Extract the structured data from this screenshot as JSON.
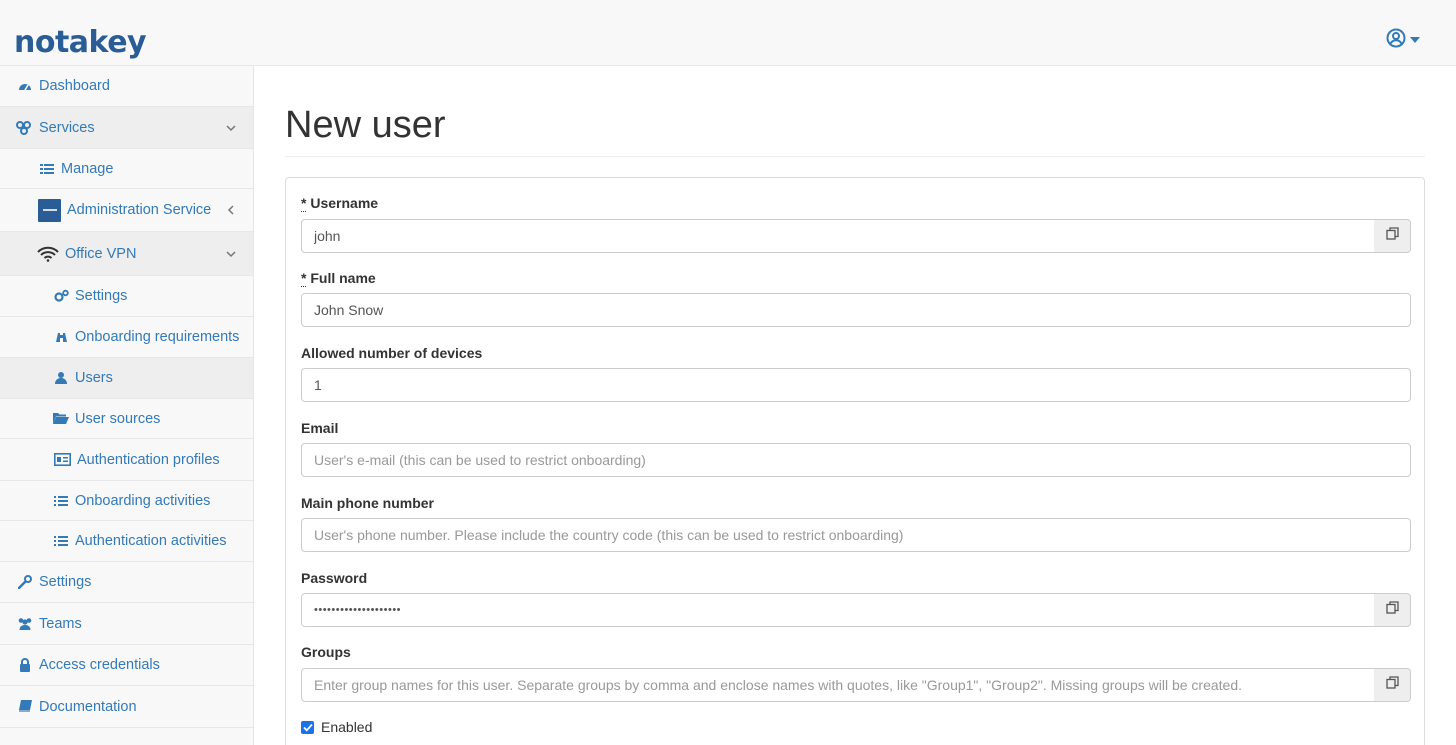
{
  "brand": {
    "logo_text": "notakey",
    "color": "#2a5d96"
  },
  "header": {
    "user_icon": "user-circle-icon",
    "dropdown_icon": "caret-down-icon"
  },
  "sidebar": {
    "items": [
      {
        "label": "Dashboard",
        "icon": "dashboard-icon"
      },
      {
        "label": "Services",
        "icon": "services-icon"
      },
      {
        "label": "Manage",
        "icon": "list-icon"
      },
      {
        "label": "Administration Service",
        "icon": "service-logo-icon"
      },
      {
        "label": "Office VPN",
        "icon": "wifi-icon"
      },
      {
        "label": "Settings",
        "icon": "cogs-icon"
      },
      {
        "label": "Onboarding requirements",
        "icon": "binoculars-icon"
      },
      {
        "label": "Users",
        "icon": "user-icon"
      },
      {
        "label": "User sources",
        "icon": "folder-open-icon"
      },
      {
        "label": "Authentication profiles",
        "icon": "id-card-icon"
      },
      {
        "label": "Onboarding activities",
        "icon": "list-icon"
      },
      {
        "label": "Authentication activities",
        "icon": "list-icon"
      },
      {
        "label": "Settings",
        "icon": "wrench-icon"
      },
      {
        "label": "Teams",
        "icon": "users-icon"
      },
      {
        "label": "Access credentials",
        "icon": "lock-icon"
      },
      {
        "label": "Documentation",
        "icon": "book-icon"
      }
    ]
  },
  "page": {
    "title": "New user"
  },
  "form": {
    "username": {
      "required_mark": "*",
      "label": "Username",
      "value": "john"
    },
    "fullname": {
      "required_mark": "*",
      "label": "Full name",
      "value": "John Snow"
    },
    "devices": {
      "label": "Allowed number of devices",
      "value": "1"
    },
    "email": {
      "label": "Email",
      "value": "",
      "placeholder": "User's e-mail (this can be used to restrict onboarding)"
    },
    "phone": {
      "label": "Main phone number",
      "value": "",
      "placeholder": "User's phone number. Please include the country code (this can be used to restrict onboarding)"
    },
    "password": {
      "label": "Password",
      "value": "••••••••••••••••••••"
    },
    "groups": {
      "label": "Groups",
      "value": "",
      "placeholder": "Enter group names for this user. Separate groups by comma and enclose names with quotes, like \"Group1\", \"Group2\". Missing groups will be created."
    },
    "enabled": {
      "label": "Enabled",
      "checked": true
    }
  },
  "colors": {
    "link": "#337ab7",
    "checkbox": "#1a73e8"
  }
}
